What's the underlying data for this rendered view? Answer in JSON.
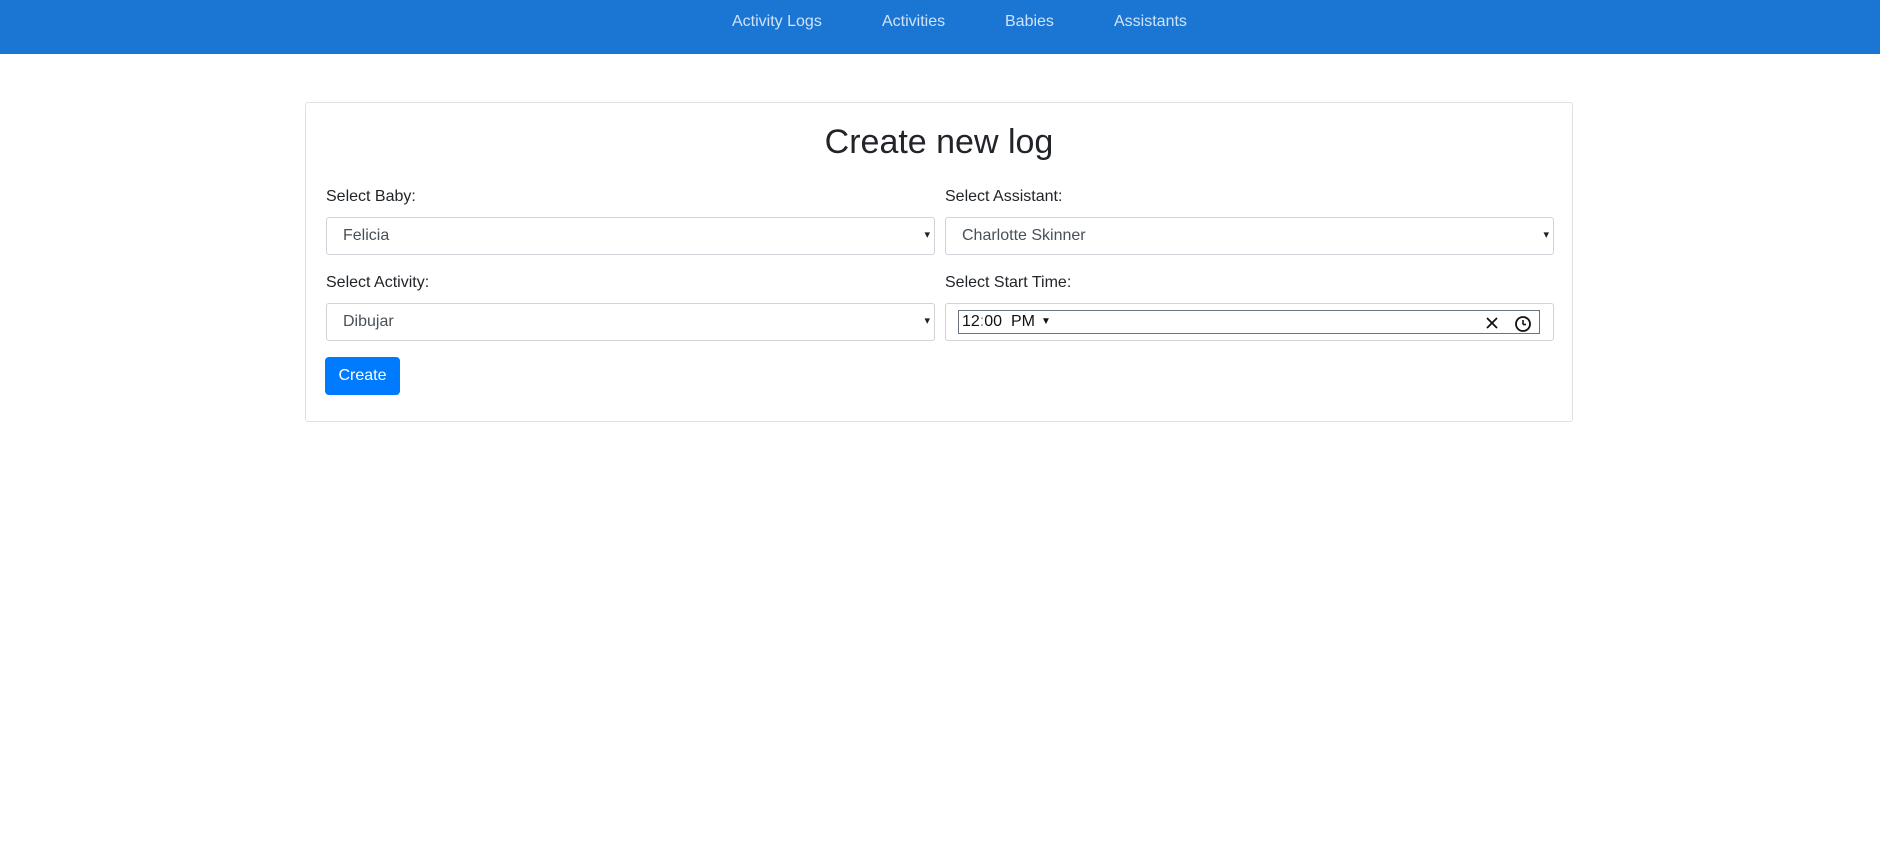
{
  "nav": {
    "items": [
      {
        "label": "Activity Logs"
      },
      {
        "label": "Activities"
      },
      {
        "label": "Babies"
      },
      {
        "label": "Assistants"
      }
    ]
  },
  "form": {
    "title": "Create new log",
    "baby": {
      "label": "Select Baby:",
      "value": "Felicia"
    },
    "assistant": {
      "label": "Select Assistant:",
      "value": "Charlotte Skinner"
    },
    "activity": {
      "label": "Select Activity:",
      "value": "Dibujar"
    },
    "start_time": {
      "label": "Select Start Time:",
      "hours": "12",
      "minutes": "00",
      "period": "PM"
    },
    "submit_label": "Create"
  },
  "icons": {
    "dropdown": "chevron-down-icon",
    "clear": "close-icon",
    "clock": "clock-icon"
  },
  "colors": {
    "navbar": "#1b76d3",
    "primary_button": "#007bff"
  }
}
